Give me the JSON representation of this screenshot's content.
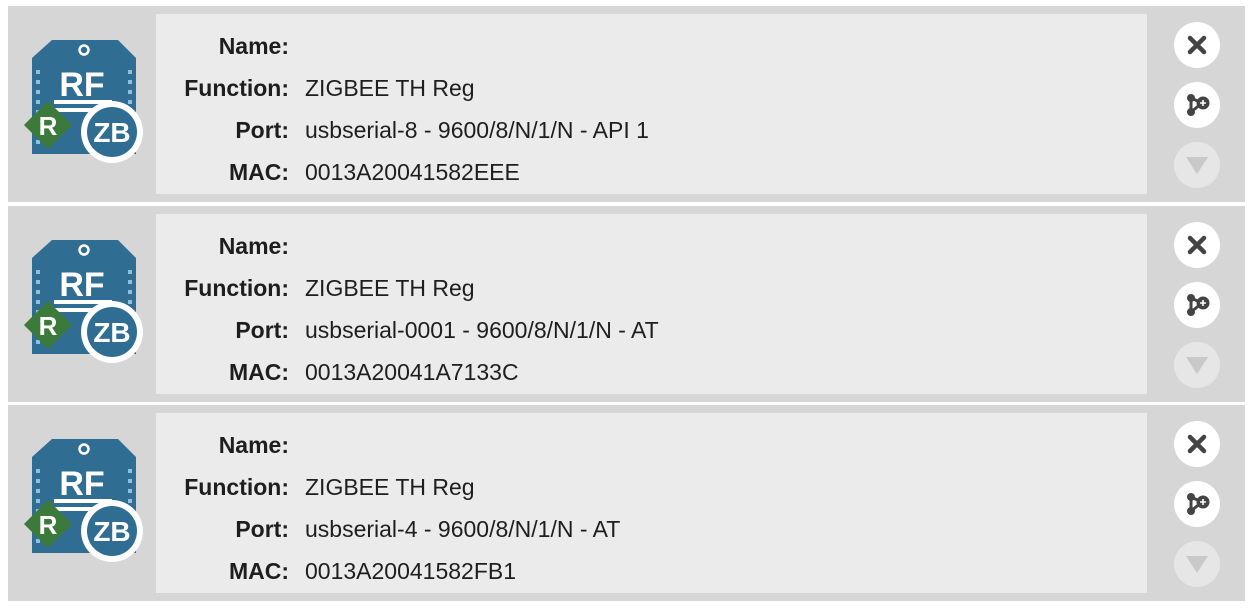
{
  "labels": {
    "name": "Name:",
    "function": "Function:",
    "port": "Port:",
    "mac": "MAC:"
  },
  "icon_text": {
    "rf": "RF",
    "zb": "ZB",
    "role": "R"
  },
  "icons": {
    "module": "xbee-rf-module-icon",
    "close": "close-icon",
    "config": "network-config-icon",
    "expand": "triangle-down-icon"
  },
  "colors": {
    "module_blue": "#2f6d93",
    "role_green": "#3c7a3c",
    "card_bg": "#d6d6d6",
    "panel_bg": "#ebebeb",
    "text": "#1e1e1e",
    "icon_dark": "#444444",
    "icon_disabled": "#c9c9c9"
  },
  "devices": [
    {
      "name": "",
      "function": "ZIGBEE TH Reg",
      "port": "usbserial-8 - 9600/8/N/1/N - API 1",
      "mac": "0013A20041582EEE"
    },
    {
      "name": "",
      "function": "ZIGBEE TH Reg",
      "port": "usbserial-0001 - 9600/8/N/1/N - AT",
      "mac": "0013A20041A7133C"
    },
    {
      "name": "",
      "function": "ZIGBEE TH Reg",
      "port": "usbserial-4 - 9600/8/N/1/N - AT",
      "mac": "0013A20041582FB1"
    }
  ]
}
